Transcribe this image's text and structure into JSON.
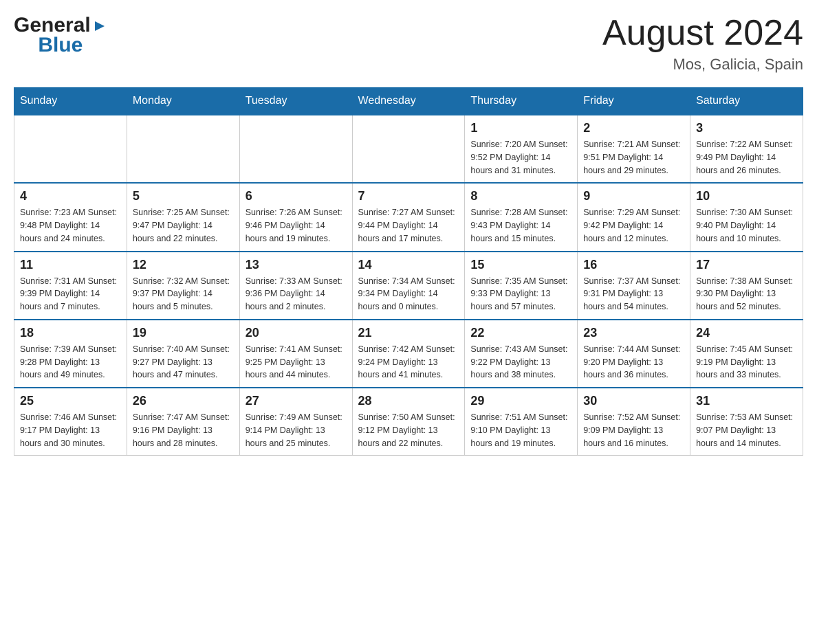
{
  "header": {
    "logo_general": "General",
    "logo_blue": "Blue",
    "month_title": "August 2024",
    "location": "Mos, Galicia, Spain"
  },
  "days_of_week": [
    "Sunday",
    "Monday",
    "Tuesday",
    "Wednesday",
    "Thursday",
    "Friday",
    "Saturday"
  ],
  "weeks": [
    {
      "days": [
        {
          "num": "",
          "info": ""
        },
        {
          "num": "",
          "info": ""
        },
        {
          "num": "",
          "info": ""
        },
        {
          "num": "",
          "info": ""
        },
        {
          "num": "1",
          "info": "Sunrise: 7:20 AM\nSunset: 9:52 PM\nDaylight: 14 hours and 31 minutes."
        },
        {
          "num": "2",
          "info": "Sunrise: 7:21 AM\nSunset: 9:51 PM\nDaylight: 14 hours and 29 minutes."
        },
        {
          "num": "3",
          "info": "Sunrise: 7:22 AM\nSunset: 9:49 PM\nDaylight: 14 hours and 26 minutes."
        }
      ]
    },
    {
      "days": [
        {
          "num": "4",
          "info": "Sunrise: 7:23 AM\nSunset: 9:48 PM\nDaylight: 14 hours and 24 minutes."
        },
        {
          "num": "5",
          "info": "Sunrise: 7:25 AM\nSunset: 9:47 PM\nDaylight: 14 hours and 22 minutes."
        },
        {
          "num": "6",
          "info": "Sunrise: 7:26 AM\nSunset: 9:46 PM\nDaylight: 14 hours and 19 minutes."
        },
        {
          "num": "7",
          "info": "Sunrise: 7:27 AM\nSunset: 9:44 PM\nDaylight: 14 hours and 17 minutes."
        },
        {
          "num": "8",
          "info": "Sunrise: 7:28 AM\nSunset: 9:43 PM\nDaylight: 14 hours and 15 minutes."
        },
        {
          "num": "9",
          "info": "Sunrise: 7:29 AM\nSunset: 9:42 PM\nDaylight: 14 hours and 12 minutes."
        },
        {
          "num": "10",
          "info": "Sunrise: 7:30 AM\nSunset: 9:40 PM\nDaylight: 14 hours and 10 minutes."
        }
      ]
    },
    {
      "days": [
        {
          "num": "11",
          "info": "Sunrise: 7:31 AM\nSunset: 9:39 PM\nDaylight: 14 hours and 7 minutes."
        },
        {
          "num": "12",
          "info": "Sunrise: 7:32 AM\nSunset: 9:37 PM\nDaylight: 14 hours and 5 minutes."
        },
        {
          "num": "13",
          "info": "Sunrise: 7:33 AM\nSunset: 9:36 PM\nDaylight: 14 hours and 2 minutes."
        },
        {
          "num": "14",
          "info": "Sunrise: 7:34 AM\nSunset: 9:34 PM\nDaylight: 14 hours and 0 minutes."
        },
        {
          "num": "15",
          "info": "Sunrise: 7:35 AM\nSunset: 9:33 PM\nDaylight: 13 hours and 57 minutes."
        },
        {
          "num": "16",
          "info": "Sunrise: 7:37 AM\nSunset: 9:31 PM\nDaylight: 13 hours and 54 minutes."
        },
        {
          "num": "17",
          "info": "Sunrise: 7:38 AM\nSunset: 9:30 PM\nDaylight: 13 hours and 52 minutes."
        }
      ]
    },
    {
      "days": [
        {
          "num": "18",
          "info": "Sunrise: 7:39 AM\nSunset: 9:28 PM\nDaylight: 13 hours and 49 minutes."
        },
        {
          "num": "19",
          "info": "Sunrise: 7:40 AM\nSunset: 9:27 PM\nDaylight: 13 hours and 47 minutes."
        },
        {
          "num": "20",
          "info": "Sunrise: 7:41 AM\nSunset: 9:25 PM\nDaylight: 13 hours and 44 minutes."
        },
        {
          "num": "21",
          "info": "Sunrise: 7:42 AM\nSunset: 9:24 PM\nDaylight: 13 hours and 41 minutes."
        },
        {
          "num": "22",
          "info": "Sunrise: 7:43 AM\nSunset: 9:22 PM\nDaylight: 13 hours and 38 minutes."
        },
        {
          "num": "23",
          "info": "Sunrise: 7:44 AM\nSunset: 9:20 PM\nDaylight: 13 hours and 36 minutes."
        },
        {
          "num": "24",
          "info": "Sunrise: 7:45 AM\nSunset: 9:19 PM\nDaylight: 13 hours and 33 minutes."
        }
      ]
    },
    {
      "days": [
        {
          "num": "25",
          "info": "Sunrise: 7:46 AM\nSunset: 9:17 PM\nDaylight: 13 hours and 30 minutes."
        },
        {
          "num": "26",
          "info": "Sunrise: 7:47 AM\nSunset: 9:16 PM\nDaylight: 13 hours and 28 minutes."
        },
        {
          "num": "27",
          "info": "Sunrise: 7:49 AM\nSunset: 9:14 PM\nDaylight: 13 hours and 25 minutes."
        },
        {
          "num": "28",
          "info": "Sunrise: 7:50 AM\nSunset: 9:12 PM\nDaylight: 13 hours and 22 minutes."
        },
        {
          "num": "29",
          "info": "Sunrise: 7:51 AM\nSunset: 9:10 PM\nDaylight: 13 hours and 19 minutes."
        },
        {
          "num": "30",
          "info": "Sunrise: 7:52 AM\nSunset: 9:09 PM\nDaylight: 13 hours and 16 minutes."
        },
        {
          "num": "31",
          "info": "Sunrise: 7:53 AM\nSunset: 9:07 PM\nDaylight: 13 hours and 14 minutes."
        }
      ]
    }
  ]
}
